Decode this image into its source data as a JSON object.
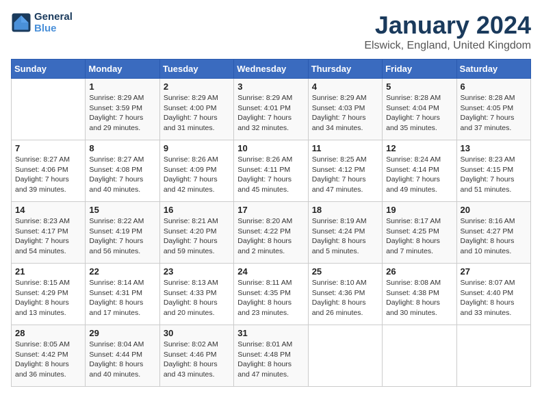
{
  "logo": {
    "line1": "General",
    "line2": "Blue"
  },
  "title": "January 2024",
  "subtitle": "Elswick, England, United Kingdom",
  "header_color": "#3a6bbf",
  "days_of_week": [
    "Sunday",
    "Monday",
    "Tuesday",
    "Wednesday",
    "Thursday",
    "Friday",
    "Saturday"
  ],
  "weeks": [
    [
      {
        "day": "",
        "info": ""
      },
      {
        "day": "1",
        "info": "Sunrise: 8:29 AM\nSunset: 3:59 PM\nDaylight: 7 hours\nand 29 minutes."
      },
      {
        "day": "2",
        "info": "Sunrise: 8:29 AM\nSunset: 4:00 PM\nDaylight: 7 hours\nand 31 minutes."
      },
      {
        "day": "3",
        "info": "Sunrise: 8:29 AM\nSunset: 4:01 PM\nDaylight: 7 hours\nand 32 minutes."
      },
      {
        "day": "4",
        "info": "Sunrise: 8:29 AM\nSunset: 4:03 PM\nDaylight: 7 hours\nand 34 minutes."
      },
      {
        "day": "5",
        "info": "Sunrise: 8:28 AM\nSunset: 4:04 PM\nDaylight: 7 hours\nand 35 minutes."
      },
      {
        "day": "6",
        "info": "Sunrise: 8:28 AM\nSunset: 4:05 PM\nDaylight: 7 hours\nand 37 minutes."
      }
    ],
    [
      {
        "day": "7",
        "info": "Sunrise: 8:27 AM\nSunset: 4:06 PM\nDaylight: 7 hours\nand 39 minutes."
      },
      {
        "day": "8",
        "info": "Sunrise: 8:27 AM\nSunset: 4:08 PM\nDaylight: 7 hours\nand 40 minutes."
      },
      {
        "day": "9",
        "info": "Sunrise: 8:26 AM\nSunset: 4:09 PM\nDaylight: 7 hours\nand 42 minutes."
      },
      {
        "day": "10",
        "info": "Sunrise: 8:26 AM\nSunset: 4:11 PM\nDaylight: 7 hours\nand 45 minutes."
      },
      {
        "day": "11",
        "info": "Sunrise: 8:25 AM\nSunset: 4:12 PM\nDaylight: 7 hours\nand 47 minutes."
      },
      {
        "day": "12",
        "info": "Sunrise: 8:24 AM\nSunset: 4:14 PM\nDaylight: 7 hours\nand 49 minutes."
      },
      {
        "day": "13",
        "info": "Sunrise: 8:23 AM\nSunset: 4:15 PM\nDaylight: 7 hours\nand 51 minutes."
      }
    ],
    [
      {
        "day": "14",
        "info": "Sunrise: 8:23 AM\nSunset: 4:17 PM\nDaylight: 7 hours\nand 54 minutes."
      },
      {
        "day": "15",
        "info": "Sunrise: 8:22 AM\nSunset: 4:19 PM\nDaylight: 7 hours\nand 56 minutes."
      },
      {
        "day": "16",
        "info": "Sunrise: 8:21 AM\nSunset: 4:20 PM\nDaylight: 7 hours\nand 59 minutes."
      },
      {
        "day": "17",
        "info": "Sunrise: 8:20 AM\nSunset: 4:22 PM\nDaylight: 8 hours\nand 2 minutes."
      },
      {
        "day": "18",
        "info": "Sunrise: 8:19 AM\nSunset: 4:24 PM\nDaylight: 8 hours\nand 5 minutes."
      },
      {
        "day": "19",
        "info": "Sunrise: 8:17 AM\nSunset: 4:25 PM\nDaylight: 8 hours\nand 7 minutes."
      },
      {
        "day": "20",
        "info": "Sunrise: 8:16 AM\nSunset: 4:27 PM\nDaylight: 8 hours\nand 10 minutes."
      }
    ],
    [
      {
        "day": "21",
        "info": "Sunrise: 8:15 AM\nSunset: 4:29 PM\nDaylight: 8 hours\nand 13 minutes."
      },
      {
        "day": "22",
        "info": "Sunrise: 8:14 AM\nSunset: 4:31 PM\nDaylight: 8 hours\nand 17 minutes."
      },
      {
        "day": "23",
        "info": "Sunrise: 8:13 AM\nSunset: 4:33 PM\nDaylight: 8 hours\nand 20 minutes."
      },
      {
        "day": "24",
        "info": "Sunrise: 8:11 AM\nSunset: 4:35 PM\nDaylight: 8 hours\nand 23 minutes."
      },
      {
        "day": "25",
        "info": "Sunrise: 8:10 AM\nSunset: 4:36 PM\nDaylight: 8 hours\nand 26 minutes."
      },
      {
        "day": "26",
        "info": "Sunrise: 8:08 AM\nSunset: 4:38 PM\nDaylight: 8 hours\nand 30 minutes."
      },
      {
        "day": "27",
        "info": "Sunrise: 8:07 AM\nSunset: 4:40 PM\nDaylight: 8 hours\nand 33 minutes."
      }
    ],
    [
      {
        "day": "28",
        "info": "Sunrise: 8:05 AM\nSunset: 4:42 PM\nDaylight: 8 hours\nand 36 minutes."
      },
      {
        "day": "29",
        "info": "Sunrise: 8:04 AM\nSunset: 4:44 PM\nDaylight: 8 hours\nand 40 minutes."
      },
      {
        "day": "30",
        "info": "Sunrise: 8:02 AM\nSunset: 4:46 PM\nDaylight: 8 hours\nand 43 minutes."
      },
      {
        "day": "31",
        "info": "Sunrise: 8:01 AM\nSunset: 4:48 PM\nDaylight: 8 hours\nand 47 minutes."
      },
      {
        "day": "",
        "info": ""
      },
      {
        "day": "",
        "info": ""
      },
      {
        "day": "",
        "info": ""
      }
    ]
  ]
}
